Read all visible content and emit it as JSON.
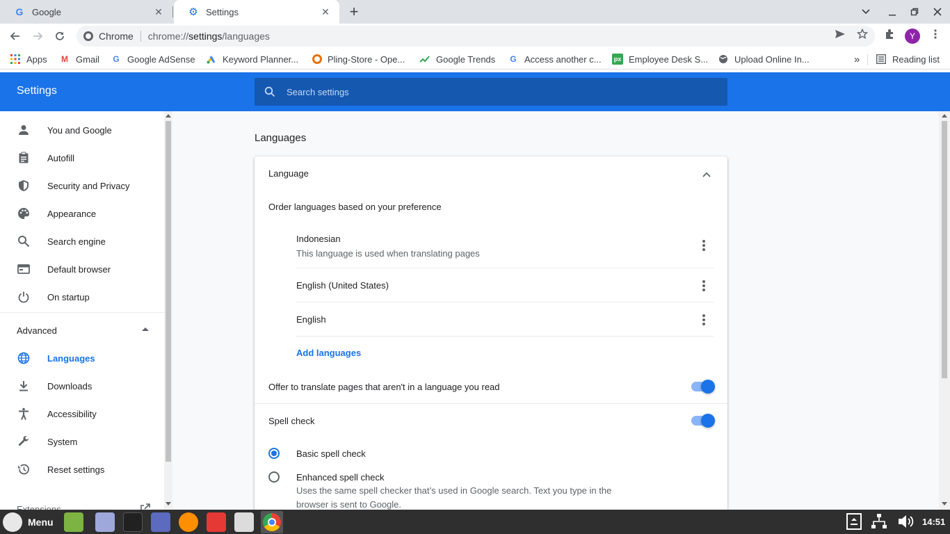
{
  "tabs": [
    {
      "title": "Google"
    },
    {
      "title": "Settings"
    }
  ],
  "omnibox": {
    "chip": "Chrome",
    "url_scheme": "chrome://",
    "url_host": "settings",
    "url_path": "/languages"
  },
  "avatar_letter": "Y",
  "bookmarks": [
    {
      "label": "Apps"
    },
    {
      "label": "Gmail"
    },
    {
      "label": "Google AdSense"
    },
    {
      "label": "Keyword Planner..."
    },
    {
      "label": "Pling-Store - Ope..."
    },
    {
      "label": "Google Trends"
    },
    {
      "label": "Access another c..."
    },
    {
      "label": "Employee Desk S..."
    },
    {
      "label": "Upload Online In..."
    }
  ],
  "bookmarks_overflow": "»",
  "reading_list": "Reading list",
  "settings": {
    "title": "Settings",
    "search_placeholder": "Search settings"
  },
  "sidebar": {
    "items": [
      {
        "label": "You and Google",
        "icon": "person-icon"
      },
      {
        "label": "Autofill",
        "icon": "clipboard-icon"
      },
      {
        "label": "Security and Privacy",
        "icon": "shield-icon"
      },
      {
        "label": "Appearance",
        "icon": "palette-icon"
      },
      {
        "label": "Search engine",
        "icon": "search-icon"
      },
      {
        "label": "Default browser",
        "icon": "browser-icon"
      },
      {
        "label": "On startup",
        "icon": "power-icon"
      }
    ],
    "advanced_label": "Advanced",
    "advanced_items": [
      {
        "label": "Languages",
        "icon": "globe-icon"
      },
      {
        "label": "Downloads",
        "icon": "download-icon"
      },
      {
        "label": "Accessibility",
        "icon": "accessibility-icon"
      },
      {
        "label": "System",
        "icon": "wrench-icon"
      },
      {
        "label": "Reset settings",
        "icon": "history-icon"
      }
    ],
    "extensions_label": "Extensions"
  },
  "main": {
    "heading": "Languages",
    "section_title": "Language",
    "order_text": "Order languages based on your preference",
    "languages": [
      {
        "name": "Indonesian",
        "sub": "This language is used when translating pages"
      },
      {
        "name": "English (United States)",
        "sub": ""
      },
      {
        "name": "English",
        "sub": ""
      }
    ],
    "add_languages": "Add languages",
    "offer_translate": "Offer to translate pages that aren't in a language you read",
    "offer_translate_on": true,
    "spell_check": "Spell check",
    "spell_check_on": true,
    "basic_spell": "Basic spell check",
    "enhanced_spell": "Enhanced spell check",
    "enhanced_desc": "Uses the same spell checker that’s used in Google search. Text you type in the browser is sent to Google.",
    "selected_spell_mode": "basic"
  },
  "taskbar": {
    "menu_label": "Menu",
    "clock": "14:51"
  },
  "colors": {
    "accent": "#1a73e8",
    "header": "#1a73e8",
    "taskbar": "#2f2f2f"
  }
}
